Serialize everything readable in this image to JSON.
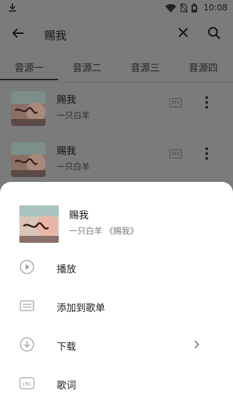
{
  "statusbar": {
    "time": "10:08"
  },
  "search": {
    "query": "赐我"
  },
  "tabs": [
    "音源一",
    "音源二",
    "音源三",
    "音源四"
  ],
  "results": [
    {
      "title": "赐我",
      "artist": "一只白羊",
      "mv": "MV"
    },
    {
      "title": "赐我",
      "artist": "一只白羊",
      "mv": "MV"
    }
  ],
  "sheet": {
    "song_title": "赐我",
    "song_sub": "一只白羊  《赐我》",
    "actions": [
      {
        "label": "播放",
        "icon": "play-circle-icon"
      },
      {
        "label": "添加到歌单",
        "icon": "playlist-add-icon"
      },
      {
        "label": "下载",
        "icon": "download-icon"
      },
      {
        "label": "歌词",
        "icon": "lrc-icon"
      }
    ]
  },
  "colors": {
    "overlay": "#7b7b7b",
    "sheet": "#ffffff",
    "icon_gray": "#9e9e9e"
  }
}
